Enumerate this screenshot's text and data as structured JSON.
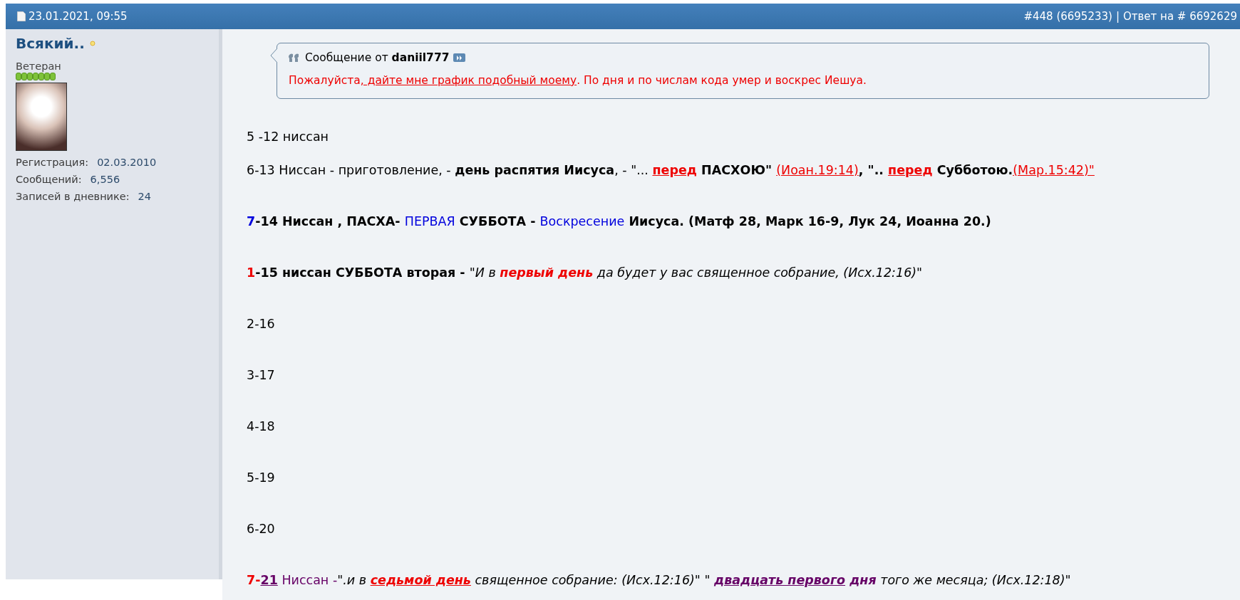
{
  "header": {
    "date": "23.01.2021, 09:55",
    "post_number": "#448 (6695233)",
    "separator": "|",
    "reply_to": "Ответ на # 6692629"
  },
  "author": {
    "name": "Всякий..",
    "rank": "Ветеран",
    "stats": [
      {
        "label": "Регистрация:",
        "value": "02.03.2010"
      },
      {
        "label": "Сообщений:",
        "value": "6,556"
      },
      {
        "label": "Записей в дневнике:",
        "value": "24"
      }
    ]
  },
  "quote": {
    "prefix": "Сообщение от",
    "author": "daniil777",
    "runs": [
      {
        "text": "Пожалуйста",
        "bold": false,
        "italic": false,
        "underline": false,
        "color": "#ee0000"
      },
      {
        "text": ", дайте мне график подобный моему",
        "bold": false,
        "italic": false,
        "underline": true,
        "color": "#ee0000"
      },
      {
        "text": ". По дня и по числам кода умер и воскрес Иешуа.",
        "bold": false,
        "italic": false,
        "underline": false,
        "color": "#ee0000"
      }
    ]
  },
  "lines": [
    [
      {
        "text": "5 -12 ниссан",
        "bold": false,
        "italic": false,
        "underline": false,
        "color": "#000000"
      }
    ],
    [
      {
        "text": "6-13 Ниссан - приготовление, - ",
        "bold": false,
        "italic": false,
        "underline": false,
        "color": "#000000"
      },
      {
        "text": "день распятия Иисуса",
        "bold": true,
        "italic": false,
        "underline": false,
        "color": "#000000"
      },
      {
        "text": ", - \"... ",
        "bold": false,
        "italic": false,
        "underline": false,
        "color": "#000000"
      },
      {
        "text": "перед",
        "bold": true,
        "italic": false,
        "underline": true,
        "color": "#ee0000"
      },
      {
        "text": " ПАСХОЮ\" ",
        "bold": true,
        "italic": false,
        "underline": false,
        "color": "#000000"
      },
      {
        "text": "(Иоан.19:14)",
        "bold": false,
        "italic": false,
        "underline": true,
        "color": "#ee0000"
      },
      {
        "text": ", \".. ",
        "bold": true,
        "italic": false,
        "underline": false,
        "color": "#000000"
      },
      {
        "text": "перед",
        "bold": true,
        "italic": false,
        "underline": true,
        "color": "#ee0000"
      },
      {
        "text": " Субботою.",
        "bold": true,
        "italic": false,
        "underline": false,
        "color": "#000000"
      },
      {
        "text": "(Мар.15:42)\"",
        "bold": false,
        "italic": false,
        "underline": true,
        "color": "#ee0000"
      }
    ],
    [
      {
        "text": "7",
        "bold": true,
        "italic": false,
        "underline": false,
        "color": "#0000dd"
      },
      {
        "text": "-14 Ниссан , ПАСХА- ",
        "bold": true,
        "italic": false,
        "underline": false,
        "color": "#000000"
      },
      {
        "text": "ПЕРВАЯ",
        "bold": false,
        "italic": false,
        "underline": false,
        "color": "#0000dd"
      },
      {
        "text": " СУББОТА - ",
        "bold": true,
        "italic": false,
        "underline": false,
        "color": "#000000"
      },
      {
        "text": "Воскресение",
        "bold": false,
        "italic": false,
        "underline": false,
        "color": "#0000dd"
      },
      {
        "text": " Иисуса. (Матф 28, Марк 16-9, Лук 24, Иоанна 20.)",
        "bold": true,
        "italic": false,
        "underline": false,
        "color": "#000000"
      }
    ],
    [
      {
        "text": "1",
        "bold": true,
        "italic": false,
        "underline": false,
        "color": "#ee0000"
      },
      {
        "text": "-15 ниссан СУББОТА вторая - ",
        "bold": true,
        "italic": false,
        "underline": false,
        "color": "#000000"
      },
      {
        "text": "\"И в ",
        "bold": false,
        "italic": true,
        "underline": false,
        "color": "#000000"
      },
      {
        "text": "первый день",
        "bold": true,
        "italic": true,
        "underline": false,
        "color": "#ee0000"
      },
      {
        "text": " да будет у вас священное собрание, (Исх.12:16)\"",
        "bold": false,
        "italic": true,
        "underline": false,
        "color": "#000000"
      }
    ],
    [
      {
        "text": "2-16",
        "bold": false,
        "italic": false,
        "underline": false,
        "color": "#000000"
      }
    ],
    [
      {
        "text": "3-17",
        "bold": false,
        "italic": false,
        "underline": false,
        "color": "#000000"
      }
    ],
    [
      {
        "text": "4-18",
        "bold": false,
        "italic": false,
        "underline": false,
        "color": "#000000"
      }
    ],
    [
      {
        "text": "5-19",
        "bold": false,
        "italic": false,
        "underline": false,
        "color": "#000000"
      }
    ],
    [
      {
        "text": "6-20",
        "bold": false,
        "italic": false,
        "underline": false,
        "color": "#000000"
      }
    ],
    [
      {
        "text": "7-",
        "bold": true,
        "italic": false,
        "underline": false,
        "color": "#ee0000"
      },
      {
        "text": "21",
        "bold": true,
        "italic": false,
        "underline": true,
        "color": "#660066"
      },
      {
        "text": " Ниссан -",
        "bold": false,
        "italic": false,
        "underline": false,
        "color": "#660066"
      },
      {
        "text": "\".и в ",
        "bold": false,
        "italic": true,
        "underline": false,
        "color": "#000000"
      },
      {
        "text": "седьмой день",
        "bold": true,
        "italic": true,
        "underline": true,
        "color": "#ee0000"
      },
      {
        "text": " священное собрание: (Исх.12:16)\" \" ",
        "bold": false,
        "italic": true,
        "underline": false,
        "color": "#000000"
      },
      {
        "text": "двадцать первого",
        "bold": true,
        "italic": true,
        "underline": true,
        "color": "#660066"
      },
      {
        "text": " дня",
        "bold": true,
        "italic": true,
        "underline": false,
        "color": "#660066"
      },
      {
        "text": " того же месяца; (Исх.12:18)\"",
        "bold": false,
        "italic": true,
        "underline": false,
        "color": "#000000"
      }
    ]
  ]
}
